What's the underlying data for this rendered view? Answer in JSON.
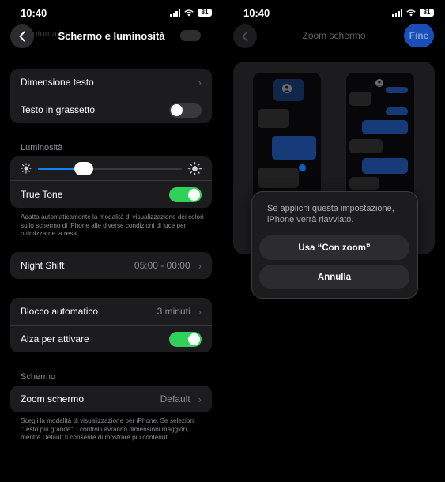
{
  "status_bar": {
    "time": "10:40",
    "battery": "81"
  },
  "left_screen": {
    "title": "Schermo e luminosità",
    "scrolled_text": "Automatico",
    "rows": {
      "text_size": "Dimensione testo",
      "bold_text": "Testo in grassetto",
      "true_tone": "True Tone",
      "night_shift": "Night Shift",
      "night_shift_value": "05:00 - 00:00",
      "auto_lock": "Blocco automatico",
      "auto_lock_value": "3 minuti",
      "raise_to_wake": "Alza per attivare",
      "display_zoom": "Zoom schermo",
      "display_zoom_value": "Default"
    },
    "toggles": {
      "bold_text": false,
      "true_tone": true,
      "raise_to_wake": true
    },
    "brightness": {
      "header": "Luminosità",
      "level": 0.32
    },
    "screen_header": "Schermo",
    "true_tone_footnote": "Adatta automaticamente la modalità di visualizzazione dei colori sullo schermo di iPhone alle diverse condizioni di luce per ottimizzarne la resa.",
    "zoom_footnote": "Scegli la modalità di visualizzazione per iPhone. Se selezioni \"Testo più grande\", i controlli avranno dimensioni maggiori, mentre Default ti consente di mostrare più contenuti."
  },
  "right_screen": {
    "title": "Zoom schermo",
    "done_label": "Fine",
    "alert": {
      "message": "Se applichi questa impostazione, iPhone verrà riavviato.",
      "confirm_label": "Usa “Con zoom”",
      "cancel_label": "Annulla"
    }
  },
  "icons": {
    "back": "chevron-left-icon",
    "chevron": "chevron-right-icon",
    "sun_small": "sun-small-icon",
    "sun_large": "sun-large-icon"
  },
  "colors": {
    "toggle_on": "#30d158",
    "accent": "#0a84ff",
    "done_button": "#1a4fb8"
  }
}
